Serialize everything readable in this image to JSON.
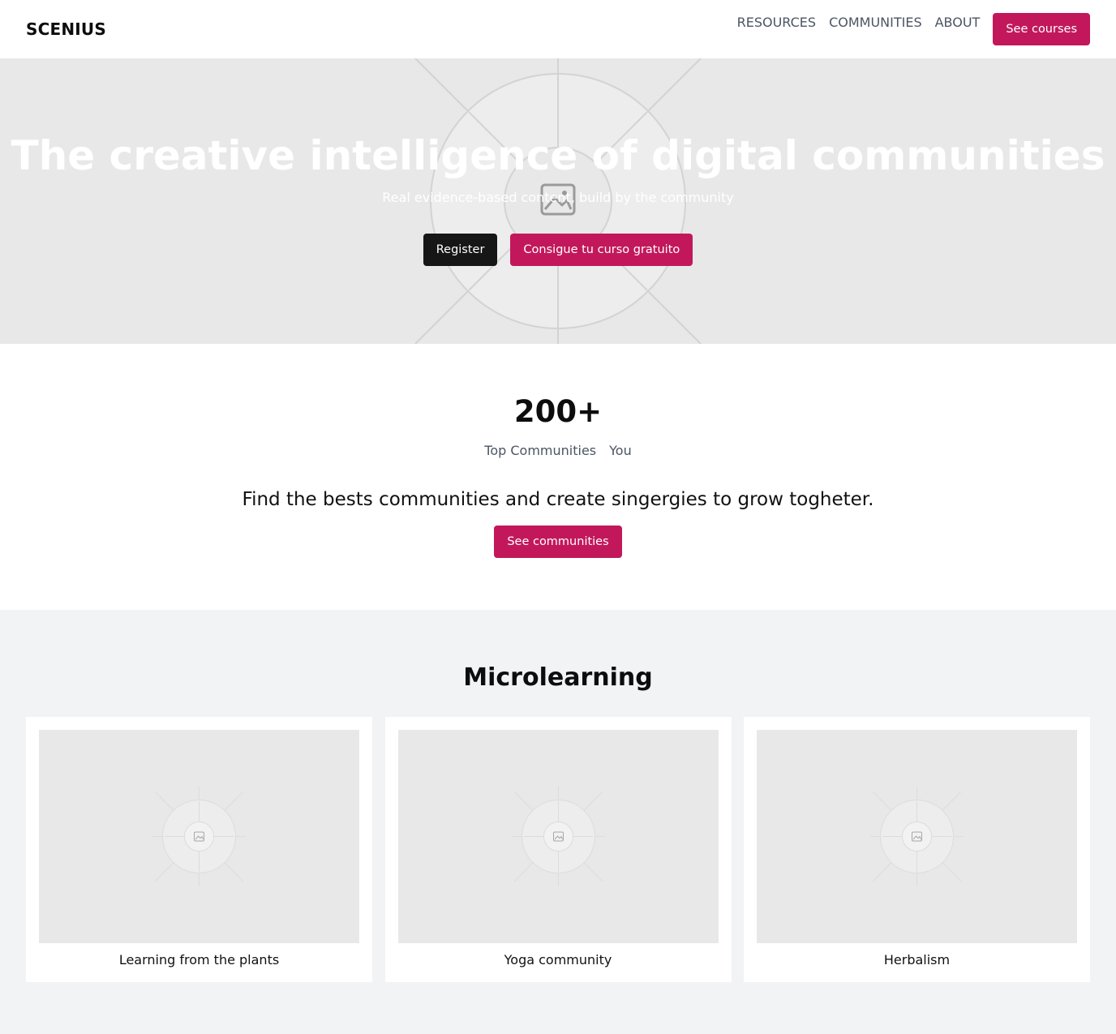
{
  "header": {
    "logo": "SCENIUS",
    "nav": [
      "RESOURCES",
      "COMMUNITIES",
      "ABOUT"
    ],
    "cta": "See courses"
  },
  "hero": {
    "title": "The creative intelligence of digital communities",
    "subtitle": "Real evidence-based content, build by the community",
    "register": "Register",
    "free_course": "Consigue tu curso gratuito"
  },
  "stats": {
    "number": "200+",
    "tabs": [
      "Top Communities",
      "You"
    ],
    "text": "Find the bests communities and create singergies to grow togheter.",
    "button": "See communities"
  },
  "micro": {
    "title": "Microlearning",
    "cards": [
      {
        "label": "Learning from the plants"
      },
      {
        "label": "Yoga community"
      },
      {
        "label": "Herbalism"
      }
    ]
  },
  "colors": {
    "accent": "#c2185b",
    "dark_button": "#161616",
    "hero_bg": "#e8e8e8",
    "section_bg": "#f2f3f5"
  },
  "icons": {
    "hero_placeholder": "image-placeholder-icon",
    "card_placeholder": "image-placeholder-icon"
  }
}
